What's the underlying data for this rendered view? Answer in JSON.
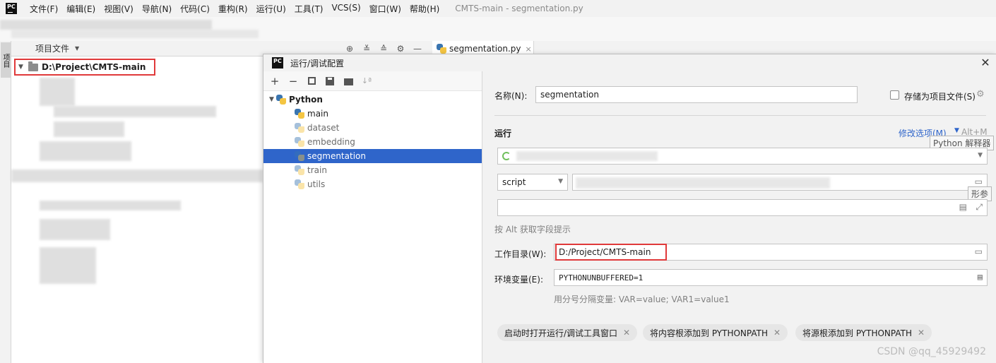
{
  "app": {
    "logo_text": "PC",
    "window_title": "CMTS-main - segmentation.py",
    "menu": [
      "文件(F)",
      "编辑(E)",
      "视图(V)",
      "导航(N)",
      "代码(C)",
      "重构(R)",
      "运行(U)",
      "工具(T)",
      "VCS(S)",
      "窗口(W)",
      "帮助(H)"
    ]
  },
  "left_strip": {
    "tab_label": "项目"
  },
  "project": {
    "header_label": "项目文件",
    "root_label": "D:\\Project\\CMTS-main"
  },
  "editor": {
    "tab_label": "segmentation.py"
  },
  "dialog": {
    "title": "运行/调试配置",
    "group": "Python",
    "configs": [
      "main",
      "dataset",
      "embedding",
      "segmentation",
      "train",
      "utils"
    ],
    "selected": "segmentation",
    "name_label": "名称(N):",
    "name_value": "segmentation",
    "store_label": "存储为项目文件(S)",
    "run_section": "运行",
    "modify_options": "修改选项(M)",
    "modify_shortcut": "Alt+M",
    "interpreter_tooltip": "Python 解释器",
    "script_type": "script",
    "params_tooltip": "形参",
    "alt_hint": "按 Alt 获取字段提示",
    "workdir_label": "工作目录(W):",
    "workdir_value": "D:/Project/CMTS-main",
    "env_label": "环境变量(E):",
    "env_value": "PYTHONUNBUFFERED=1",
    "env_hint": "用分号分隔变量: VAR=value; VAR1=value1",
    "chips": [
      "启动时打开运行/调试工具窗口",
      "将内容根添加到 PYTHONPATH",
      "将源根添加到 PYTHONPATH"
    ]
  },
  "watermark": "CSDN @qq_45929492",
  "colors": {
    "selection": "#2f65ca",
    "highlight_box": "#e0393a",
    "link": "#2f65ca"
  }
}
